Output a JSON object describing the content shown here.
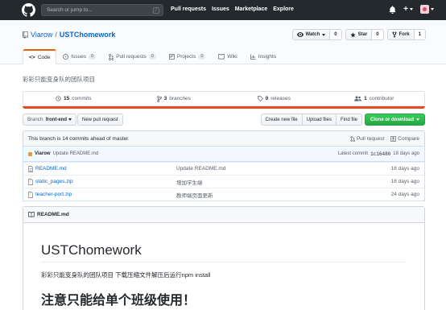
{
  "header": {
    "search_placeholder": "Search or jump to...",
    "slash_key": "/",
    "nav": [
      "Pull requests",
      "Issues",
      "Marketplace",
      "Explore"
    ],
    "plus": "+"
  },
  "repo": {
    "owner": "Viarow",
    "separator": "/",
    "name": "USTChomework",
    "watch": {
      "label": "Watch",
      "count": "0"
    },
    "star": {
      "label": "Star",
      "count": "0"
    },
    "fork": {
      "label": "Fork",
      "count": "1"
    },
    "tabs": [
      {
        "label": "Code",
        "count": ""
      },
      {
        "label": "Issues",
        "count": "0"
      },
      {
        "label": "Pull requests",
        "count": "0"
      },
      {
        "label": "Projects",
        "count": "0"
      },
      {
        "label": "Wiki",
        "count": ""
      },
      {
        "label": "Insights",
        "count": ""
      }
    ],
    "description": "彩彩只能变身队的团队项目",
    "stats": {
      "commits_count": "15",
      "commits_label": "commits",
      "branches_count": "3",
      "branches_label": "branches",
      "releases_count": "0",
      "releases_label": "releases",
      "contributors_count": "1",
      "contributors_label": "contributor"
    }
  },
  "filenav": {
    "branch_label": "Branch:",
    "branch_value": "front-end",
    "new_pr": "New pull request",
    "create_file": "Create new file",
    "upload_files": "Upload files",
    "find_file": "Find file",
    "clone": "Clone or download"
  },
  "ahead": {
    "text": "This branch is 14 commits ahead of master.",
    "pull_request": "Pull request",
    "compare": "Compare"
  },
  "latest_commit": {
    "user": "Viarow",
    "message": "Update README.md",
    "prefix": "Latest commit",
    "sha": "1c16480",
    "age": "18 days ago"
  },
  "files": [
    {
      "name": "README.md",
      "message": "Update README.md",
      "age": "18 days ago"
    },
    {
      "name": "static_pages.zip",
      "message": "增加学生端",
      "age": "18 days ago"
    },
    {
      "name": "teacher-port.zip",
      "message": "教师端页面更新",
      "age": "24 days ago"
    }
  ],
  "readme": {
    "file": "README.md",
    "title": "USTChomework",
    "paragraph": "彩彩只能变身队的团队项目 下载压缩文件解压后运行npm install",
    "h2": "注意只能给单个班级使用！"
  },
  "colors": {
    "header_bg": "#24292e",
    "link": "#0366d6",
    "green": "#28a745",
    "tab_accent": "#e36209",
    "lang_bar": "#e34c26"
  }
}
